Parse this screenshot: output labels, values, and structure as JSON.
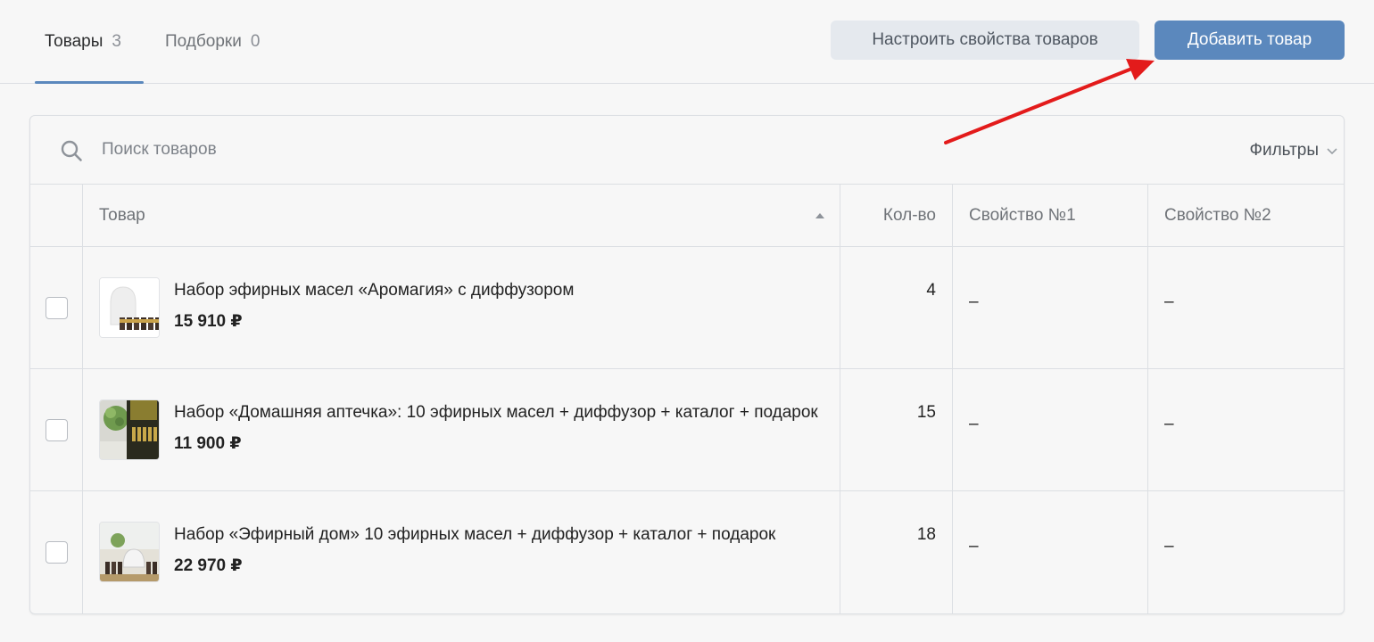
{
  "tabs": [
    {
      "label": "Товары",
      "count": "3"
    },
    {
      "label": "Подборки",
      "count": "0"
    }
  ],
  "buttons": {
    "settings": "Настроить свойства товаров",
    "add": "Добавить товар"
  },
  "search": {
    "placeholder": "Поиск товаров",
    "filters_label": "Фильтры"
  },
  "table": {
    "headers": {
      "name": "Товар",
      "qty": "Кол-во",
      "prop1": "Свойство №1",
      "prop2": "Свойство №2"
    },
    "rows": [
      {
        "name": "Набор эфирных масел «Аромагия» с диффузором",
        "price": "15 910 ₽",
        "qty": "4",
        "prop1": "–",
        "prop2": "–"
      },
      {
        "name": "Набор «Домашняя аптечка»: 10 эфирных масел + диффузор + каталог + подарок",
        "price": "11 900 ₽",
        "qty": "15",
        "prop1": "–",
        "prop2": "–"
      },
      {
        "name": "Набор «Эфирный дом» 10 эфирных масел + диффузор + каталог + подарок",
        "price": "22 970 ₽",
        "qty": "18",
        "prop1": "–",
        "prop2": "–"
      }
    ]
  },
  "colors": {
    "accent": "#5b88bd",
    "annotation_arrow": "#e31b1b"
  },
  "icons": [
    "search-icon",
    "chevron-down-icon",
    "sort-up-icon"
  ]
}
